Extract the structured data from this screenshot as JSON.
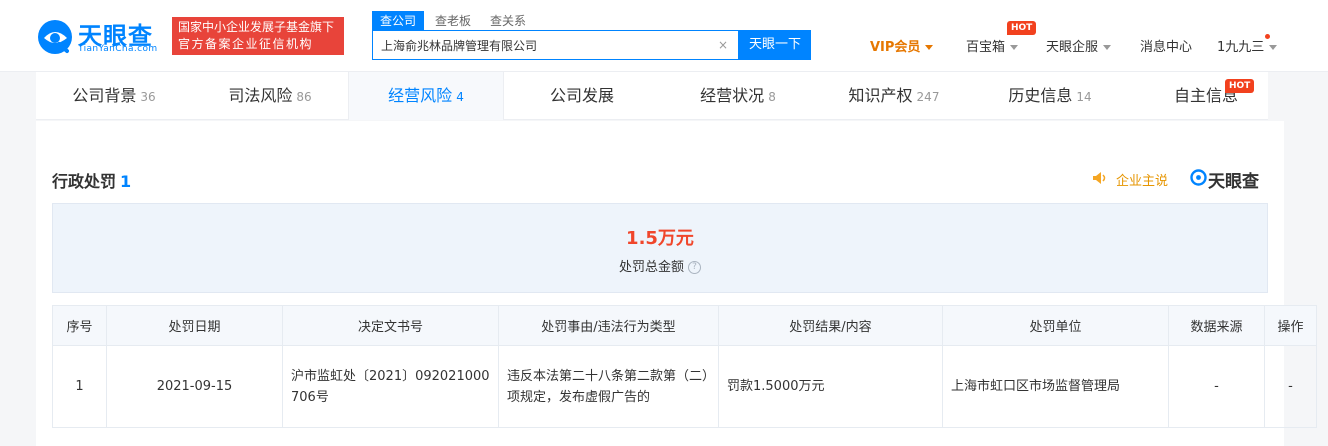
{
  "header": {
    "logo": {
      "title": "天眼查",
      "subtitle": "TianYanCha.com"
    },
    "badge": {
      "line1": "国家中小企业发展子基金旗下",
      "line2": "官方备案企业征信机构"
    },
    "search": {
      "tabs": [
        "查公司",
        "查老板",
        "查关系"
      ],
      "value": "上海俞兆林品牌管理有限公司",
      "clear": "×",
      "button": "天眼一下"
    },
    "nav": {
      "vip": "VIP会员",
      "treasure": "百宝箱",
      "hot": "HOT",
      "enterprise": "天眼企服",
      "messages": "消息中心",
      "user": "1九九三"
    }
  },
  "tabs": [
    {
      "label": "公司背景",
      "count": "36"
    },
    {
      "label": "司法风险",
      "count": "86"
    },
    {
      "label": "经营风险",
      "count": "4"
    },
    {
      "label": "公司发展",
      "count": ""
    },
    {
      "label": "经营状况",
      "count": "8"
    },
    {
      "label": "知识产权",
      "count": "247"
    },
    {
      "label": "历史信息",
      "count": "14"
    },
    {
      "label": "自主信息",
      "count": ""
    }
  ],
  "tab_hot": "HOT",
  "section": {
    "title": "行政处罚",
    "count": "1",
    "company_say": "企业主说",
    "brand": "天眼查"
  },
  "summary": {
    "amount": "1.5万元",
    "label": "处罚总金额",
    "help": "?"
  },
  "table": {
    "headers": [
      "序号",
      "处罚日期",
      "决定文书号",
      "处罚事由/违法行为类型",
      "处罚结果/内容",
      "处罚单位",
      "数据来源",
      "操作"
    ],
    "rows": [
      {
        "index": "1",
        "date": "2021-09-15",
        "doc_no": "沪市监虹处〔2021〕092021000706号",
        "reason": "违反本法第二十八条第二款第（二）项规定，发布虚假广告的",
        "result": "罚款1.5000万元",
        "unit": "上海市虹口区市场监督管理局",
        "source": "-",
        "action": "-"
      }
    ]
  },
  "colors": {
    "brand_blue": "#0084ff",
    "vip_orange": "#e67700",
    "amount_red": "#f0462b",
    "hot_red": "#f2411e"
  }
}
